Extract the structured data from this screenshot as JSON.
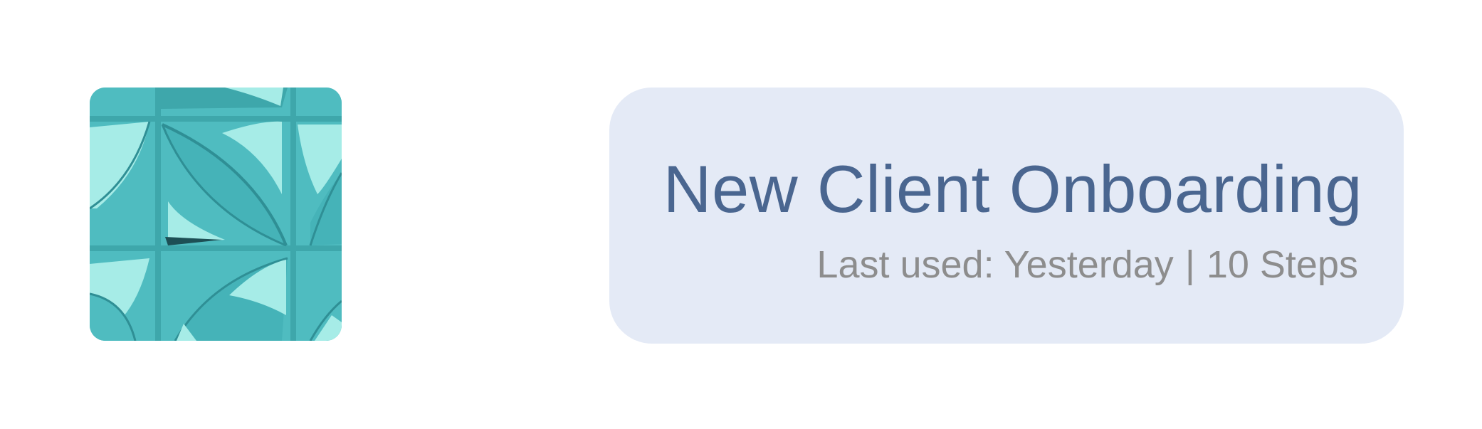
{
  "thumbnail": {
    "icon": "teal-geometric-pattern-image",
    "colors": {
      "base": "#4fbcc0",
      "light": "#a6ece7",
      "dark": "#2f8f95",
      "groove": "#3ea7ab"
    }
  },
  "card": {
    "title": "New Client Onboarding",
    "last_used_label": "Last used:",
    "last_used_value": "Yesterday",
    "separator": "|",
    "steps": "10 Steps",
    "colors": {
      "background": "#e4eaf6",
      "title": "#4a6690",
      "meta": "#8d8d8d"
    }
  }
}
